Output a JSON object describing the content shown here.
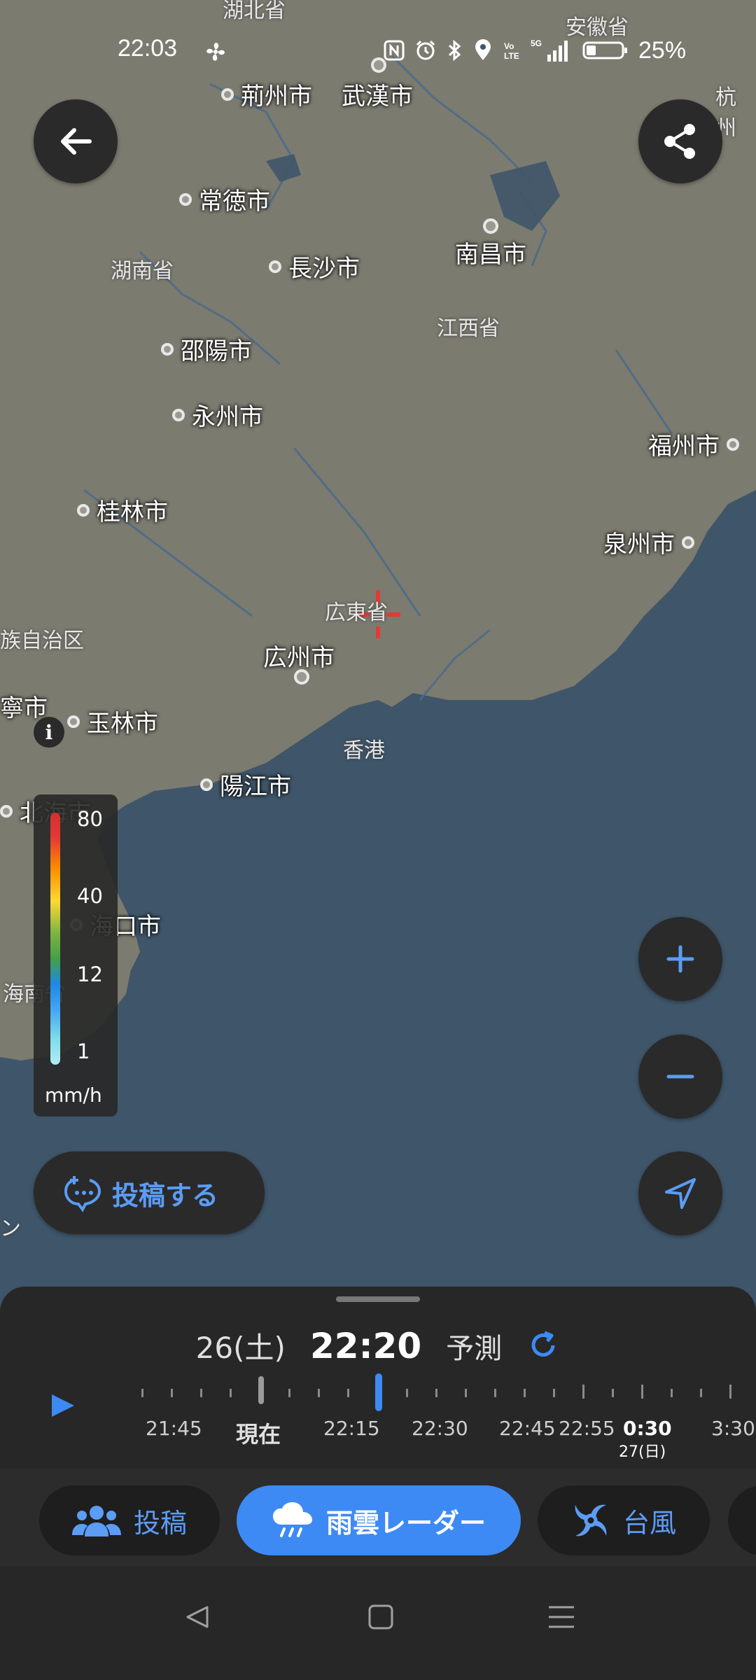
{
  "status_bar": {
    "time": "22:03",
    "network": "5G",
    "battery": "25%"
  },
  "map": {
    "cities": [
      {
        "name": "荊州市"
      },
      {
        "name": "武漢市"
      },
      {
        "name": "常徳市"
      },
      {
        "name": "南昌市"
      },
      {
        "name": "長沙市"
      },
      {
        "name": "邵陽市"
      },
      {
        "name": "永州市"
      },
      {
        "name": "福州市"
      },
      {
        "name": "桂林市"
      },
      {
        "name": "泉州市"
      },
      {
        "name": "広州市"
      },
      {
        "name": "玉林市"
      },
      {
        "name": "陽江市"
      },
      {
        "name": "海口市"
      },
      {
        "name": "北海市"
      }
    ],
    "labels": [
      "湖北省",
      "安徽省",
      "杭州",
      "湖南省",
      "江西省",
      "広東省",
      "香港",
      "族自治区",
      "寧市",
      "海南省",
      "ン"
    ]
  },
  "legend": {
    "ticks": [
      "80",
      "40",
      "12",
      "1"
    ],
    "unit": "mm/h"
  },
  "post_button": {
    "label": "投稿する"
  },
  "timeline": {
    "date": "26(土)",
    "time": "22:20",
    "mode": "予測",
    "labels": [
      "21:45",
      "現在",
      "22:15",
      "22:30",
      "22:45",
      "22:55",
      "0:30",
      "3:30"
    ],
    "next_day": "27(日)"
  },
  "tabs": [
    {
      "label": "投稿"
    },
    {
      "label": "雨雲レーダー"
    },
    {
      "label": "台風"
    }
  ],
  "colors": {
    "accent": "#3d8af5",
    "water": "#3f5569",
    "land": "#7c7b70"
  }
}
